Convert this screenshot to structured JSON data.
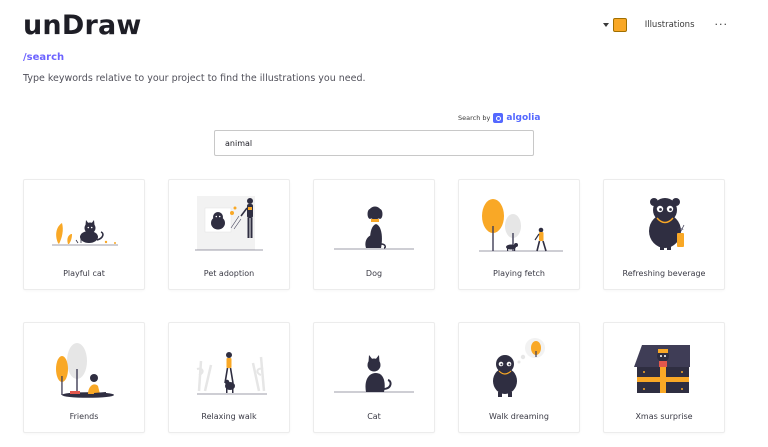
{
  "brand": {
    "logo": "unDraw"
  },
  "breadcrumb": "/search",
  "subtitle": "Type keywords relative to your project to find the illustrations you need.",
  "header": {
    "accent_color": "#f9a826",
    "nav_label": "Illustrations",
    "more_label": "···"
  },
  "search": {
    "powered_by_label": "Search by",
    "provider_name": "algolia",
    "value": "animal"
  },
  "illustrations": [
    {
      "title": "Playful cat",
      "icon": "playful-cat-illustration"
    },
    {
      "title": "Pet adoption",
      "icon": "pet-adoption-illustration"
    },
    {
      "title": "Dog",
      "icon": "dog-illustration"
    },
    {
      "title": "Playing fetch",
      "icon": "playing-fetch-illustration"
    },
    {
      "title": "Refreshing beverage",
      "icon": "refreshing-beverage-illustration"
    },
    {
      "title": "Friends",
      "icon": "friends-illustration"
    },
    {
      "title": "Relaxing walk",
      "icon": "relaxing-walk-illustration"
    },
    {
      "title": "Cat",
      "icon": "cat-illustration"
    },
    {
      "title": "Walk dreaming",
      "icon": "walk-dreaming-illustration"
    },
    {
      "title": "Xmas surprise",
      "icon": "xmas-surprise-illustration"
    }
  ]
}
